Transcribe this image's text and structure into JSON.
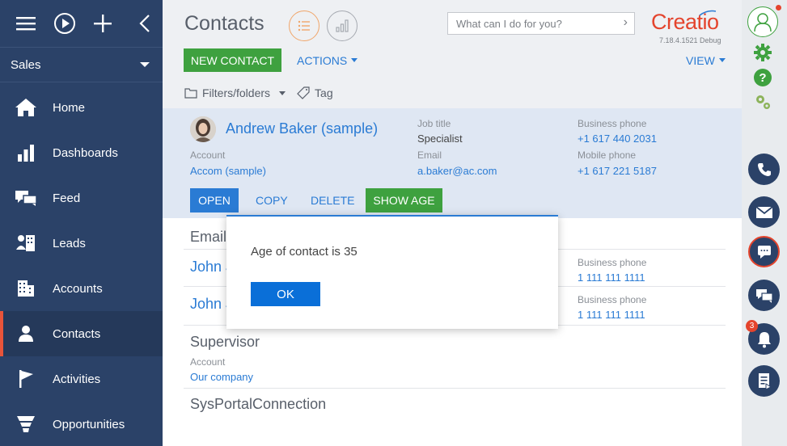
{
  "sidebar": {
    "workplace": "Sales",
    "items": [
      {
        "label": "Home",
        "icon": "home-icon"
      },
      {
        "label": "Dashboards",
        "icon": "dashboards-icon"
      },
      {
        "label": "Feed",
        "icon": "feed-icon"
      },
      {
        "label": "Leads",
        "icon": "leads-icon"
      },
      {
        "label": "Accounts",
        "icon": "accounts-icon"
      },
      {
        "label": "Contacts",
        "icon": "contacts-icon",
        "active": true
      },
      {
        "label": "Activities",
        "icon": "activities-icon"
      },
      {
        "label": "Opportunities",
        "icon": "opportunities-icon"
      }
    ]
  },
  "header": {
    "title": "Contacts",
    "search_placeholder": "What can I do for you?",
    "logo": "Creatio",
    "version": "7.18.4.1521 Debug",
    "new_contact": "NEW CONTACT",
    "actions": "ACTIONS",
    "view": "VIEW",
    "filters": "Filters/folders",
    "tag": "Tag"
  },
  "selected_contact": {
    "name": "Andrew Baker (sample)",
    "account_label": "Account",
    "account": "Accom (sample)",
    "job_title_label": "Job title",
    "job_title": "Specialist",
    "email_label": "Email",
    "email": "a.baker@ac.com",
    "business_phone_label": "Business phone",
    "business_phone": "+1 617 440 2031",
    "mobile_phone_label": "Mobile phone",
    "mobile_phone": "+1 617 221 5187",
    "actions": {
      "open": "OPEN",
      "copy": "COPY",
      "delete": "DELETE",
      "show_age": "SHOW AGE"
    }
  },
  "list": {
    "row1_title": "Email",
    "row2_name": "John J",
    "row2_phone_label": "Business phone",
    "row2_phone": "1 111 111 1111",
    "row3_name": "John J",
    "row3_phone_label": "Business phone",
    "row3_phone": "1 111 111 1111",
    "row4_title": "Supervisor",
    "row4_account_label": "Account",
    "row4_account": "Our company",
    "row5_title": "SysPortalConnection"
  },
  "rightbar": {
    "notification_count": "3"
  },
  "dialog": {
    "message": "Age of contact is 35",
    "ok": "OK"
  },
  "colors": {
    "sidebar": "#2b4268",
    "accent": "#2a7bd4",
    "green": "#3ea13f",
    "active_marker": "#e8543a"
  }
}
